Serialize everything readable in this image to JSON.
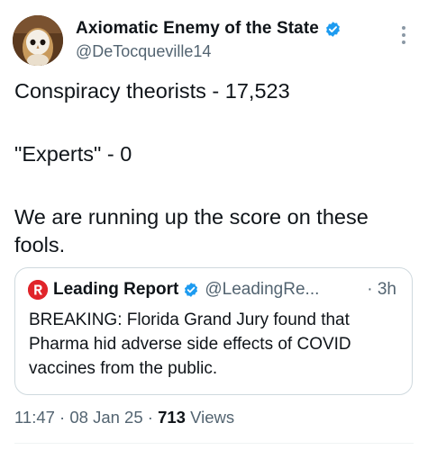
{
  "author": {
    "display_name": "Axiomatic Enemy of the State",
    "handle": "@DeTocqueville14",
    "avatar": "owl-avatar",
    "verified_badge": "verified-check-icon"
  },
  "more_icon": "more-vertical-icon",
  "tweet": {
    "lines": [
      "Conspiracy theorists - 17,523",
      "\"Experts\" - 0",
      "We are running up the score on these fools."
    ]
  },
  "quote": {
    "logo": "leading-report-logo",
    "display_name": "Leading Report",
    "handle": "@LeadingRe...",
    "time": "· 3h",
    "text": "BREAKING: Florida Grand Jury found that Pharma hid adverse side effects of COVID vaccines from the public."
  },
  "meta": {
    "timestamp": "11:47 · 08 Jan 25 · ",
    "views_count": "713",
    "views_label": " Views"
  },
  "colors": {
    "text": "#0f1419",
    "secondary": "#536471",
    "verified": "#1d9bf0",
    "border": "#cfd9de",
    "leading_report_red": "#e0242a"
  }
}
